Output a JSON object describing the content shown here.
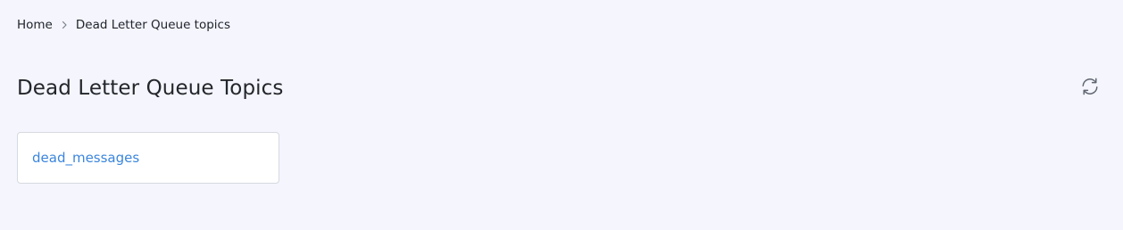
{
  "breadcrumb": {
    "home_label": "Home",
    "current_label": "Dead Letter Queue topics",
    "separator_icon": "chevron-right-icon"
  },
  "header": {
    "title": "Dead Letter Queue Topics",
    "refresh_icon": "refresh-icon"
  },
  "topics": [
    {
      "name": "dead_messages"
    }
  ],
  "colors": {
    "background": "#f4f5fd",
    "link": "#3b86dd",
    "card_border": "#d6d9e0",
    "icon": "#5f6570"
  }
}
